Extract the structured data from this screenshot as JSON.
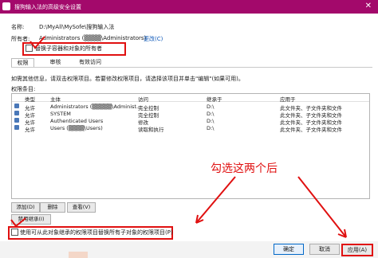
{
  "window": {
    "title": "搜狗输入法的高级安全设置",
    "close": "✕"
  },
  "name_label": "名称:",
  "name_value": "D:\\MyAll\\MySofe\\搜狗输入法",
  "owner_label": "所有者:",
  "owner_value": "Administrators (▒▒▒▒\\Administrators)",
  "owner_change": "更改(C)",
  "replace_owner_label": "替换子容器和对象的所有者",
  "tabs": [
    "权限",
    "审核",
    "有效访问"
  ],
  "info_text": "如需其他信息，请双击权限项目。若要修改权限项目，请选择该项目并单击\"编辑\"(如果可用)。",
  "entries_label": "权限条目:",
  "table": {
    "headers": [
      "类型",
      "主体",
      "访问",
      "继承于",
      "应用于"
    ],
    "rows": [
      [
        "允许",
        "Administrators (▒▒▒▒▒\\Administ...",
        "完全控制",
        "D:\\",
        "此文件夹、子文件夹和文件"
      ],
      [
        "允许",
        "SYSTEM",
        "完全控制",
        "D:\\",
        "此文件夹、子文件夹和文件"
      ],
      [
        "允许",
        "Authenticated Users",
        "修改",
        "D:\\",
        "此文件夹、子文件夹和文件"
      ],
      [
        "允许",
        "Users (▒▒▒▒\\Users)",
        "读取和执行",
        "D:\\",
        "此文件夹、子文件夹和文件"
      ]
    ]
  },
  "buttons": {
    "add": "添加(D)",
    "delete": "删除",
    "view": "查看(V)",
    "disable_inherit": "禁用继承(I)"
  },
  "replace_children_label": "使用可从此对象继承的权限项目替换所有子对象的权限项目(P)",
  "footer": {
    "ok": "确定",
    "cancel": "取消",
    "apply": "应用(A)"
  },
  "annotation": "勾选这两个后",
  "colors": {
    "titlebar": "#a3096b",
    "annotation": "#e01010"
  }
}
